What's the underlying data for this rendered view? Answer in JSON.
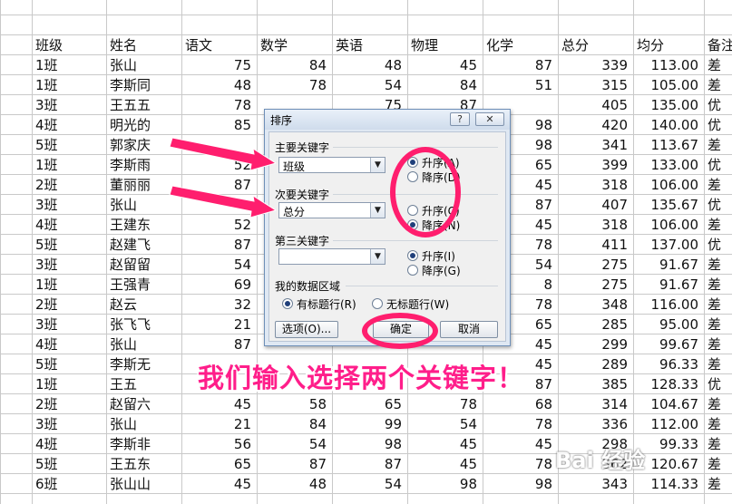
{
  "columns": [
    "班级",
    "姓名",
    "语文",
    "数学",
    "英语",
    "物理",
    "化学",
    "总分",
    "均分",
    "备注"
  ],
  "rows": [
    [
      "1班",
      "张山",
      "75",
      "84",
      "48",
      "45",
      "87",
      "339",
      "113.00",
      "差"
    ],
    [
      "1班",
      "李斯同",
      "48",
      "78",
      "54",
      "84",
      "51",
      "315",
      "105.00",
      "差"
    ],
    [
      "3班",
      "王五五",
      "78",
      "",
      "75",
      "87",
      "",
      "405",
      "135.00",
      "优"
    ],
    [
      "4班",
      "明光的",
      "85",
      "",
      "",
      "",
      "98",
      "420",
      "140.00",
      "优"
    ],
    [
      "5班",
      "郭家庆",
      "",
      "",
      "",
      "",
      "98",
      "341",
      "113.67",
      "差"
    ],
    [
      "1班",
      "李斯雨",
      "52",
      "",
      "",
      "",
      "65",
      "399",
      "133.00",
      "优"
    ],
    [
      "2班",
      "董丽丽",
      "87",
      "",
      "",
      "",
      "45",
      "318",
      "106.00",
      "差"
    ],
    [
      "3班",
      "张山",
      "",
      "",
      "",
      "",
      "87",
      "407",
      "135.67",
      "优"
    ],
    [
      "4班",
      "王建东",
      "52",
      "",
      "",
      "",
      "45",
      "318",
      "106.00",
      "差"
    ],
    [
      "5班",
      "赵建飞",
      "87",
      "",
      "",
      "",
      "78",
      "411",
      "137.00",
      "优"
    ],
    [
      "3班",
      "赵留留",
      "54",
      "",
      "",
      "",
      "54",
      "275",
      "91.67",
      "差"
    ],
    [
      "1班",
      "王强青",
      "69",
      "",
      "",
      "",
      "8",
      "275",
      "91.67",
      "差"
    ],
    [
      "2班",
      "赵云",
      "32",
      "",
      "",
      "",
      "78",
      "348",
      "116.00",
      "差"
    ],
    [
      "3班",
      "张飞飞",
      "21",
      "",
      "",
      "",
      "65",
      "285",
      "95.00",
      "差"
    ],
    [
      "4班",
      "张山",
      "87",
      "",
      "",
      "",
      "45",
      "299",
      "99.67",
      "差"
    ],
    [
      "5班",
      "李斯无",
      "",
      "",
      "",
      "",
      "45",
      "289",
      "96.33",
      "差"
    ],
    [
      "1班",
      "王五",
      "",
      "",
      "",
      "",
      "87",
      "385",
      "128.33",
      "优"
    ],
    [
      "2班",
      "赵留六",
      "45",
      "58",
      "65",
      "78",
      "68",
      "314",
      "104.67",
      "差"
    ],
    [
      "3班",
      "张山",
      "21",
      "84",
      "99",
      "54",
      "78",
      "336",
      "112.00",
      "差"
    ],
    [
      "4班",
      "李斯非",
      "56",
      "54",
      "98",
      "45",
      "45",
      "298",
      "99.33",
      "差"
    ],
    [
      "5班",
      "王五东",
      "65",
      "87",
      "87",
      "45",
      "78",
      "362",
      "120.67",
      "差"
    ],
    [
      "6班",
      "张山山",
      "45",
      "48",
      "54",
      "98",
      "98",
      "343",
      "114.33",
      "差"
    ]
  ],
  "dialog": {
    "title": "排序",
    "help_label": "?",
    "close_label": "✕",
    "primary_key_label": "主要关键字",
    "primary_key_value": "班级",
    "primary_asc": "升序(A)",
    "primary_desc": "降序(D)",
    "secondary_key_label": "次要关键字",
    "secondary_key_value": "总分",
    "secondary_asc": "升序(C)",
    "secondary_desc": "降序(N)",
    "third_key_label": "第三关键字",
    "third_key_value": "",
    "third_asc": "升序(I)",
    "third_desc": "降序(G)",
    "data_region_label": "我的数据区域",
    "has_header": "有标题行(R)",
    "no_header": "无标题行(W)",
    "options_button": "选项(O)...",
    "ok_button": "确定",
    "cancel_button": "取消",
    "primary_order": "asc",
    "secondary_order": "desc",
    "third_order": "asc",
    "header_choice": "has_header"
  },
  "annotation": {
    "caption": "我们输入选择两个关键字！",
    "color": "#ff1e6e"
  },
  "watermark": "Bai 经验"
}
